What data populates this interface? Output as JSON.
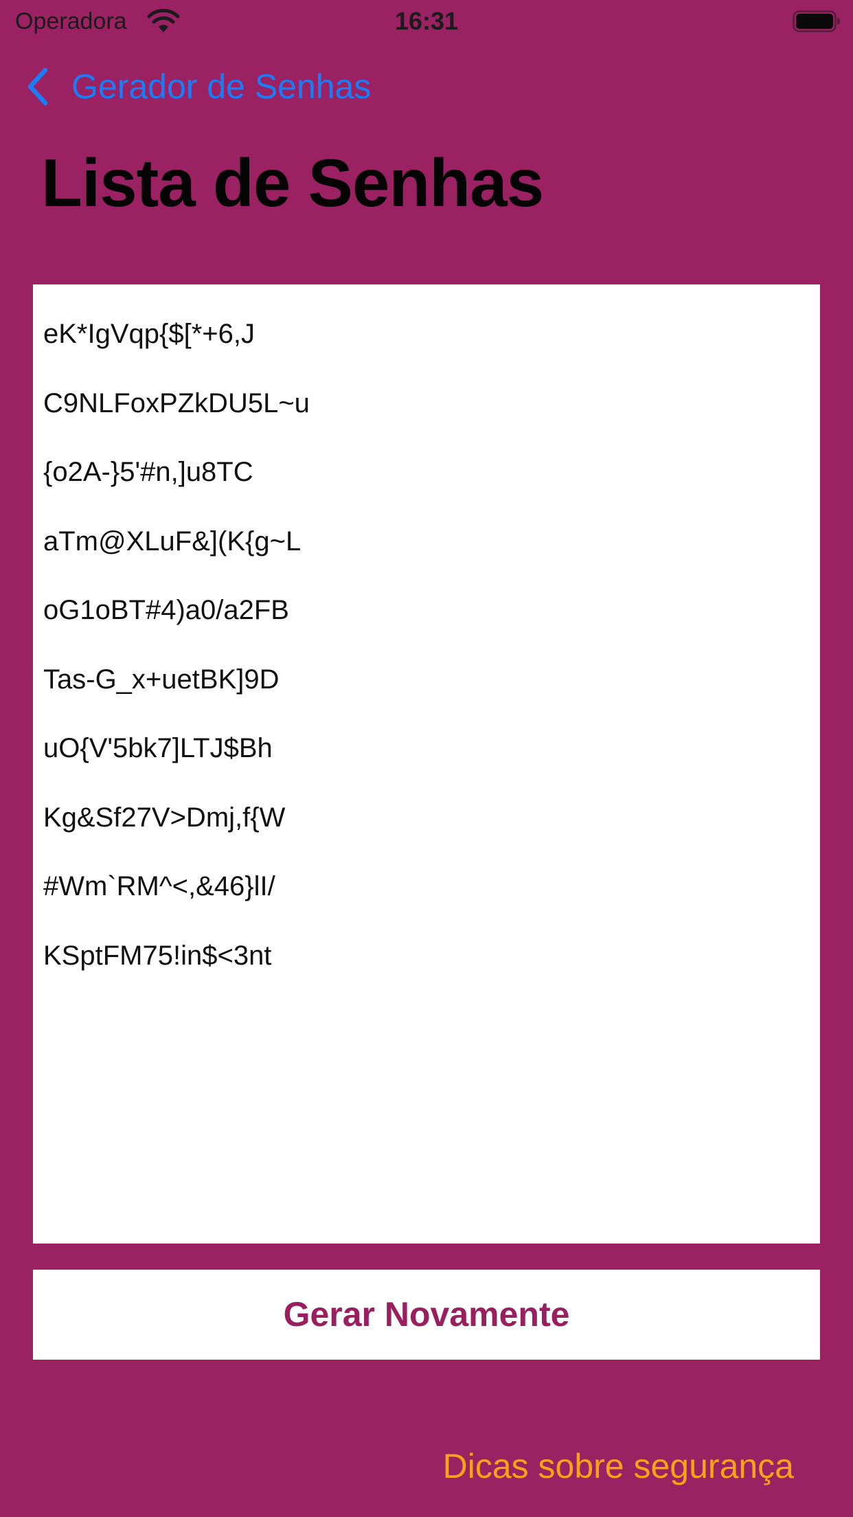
{
  "status_bar": {
    "carrier": "Operadora",
    "time": "16:31",
    "wifi_icon": "wifi-icon",
    "battery_icon": "battery-icon",
    "battery_level": 1.0
  },
  "nav": {
    "back_icon": "chevron-left-icon",
    "back_label": "Gerador de Senhas"
  },
  "page": {
    "title": "Lista de Senhas"
  },
  "passwords": [
    "eK*IgVqp{$[*+6,J",
    "C9NLFoxPZkDU5L~u",
    "{o2A-}5'#n,]u8TC",
    "aTm@XLuF&](K{g~L",
    "oG1oBT#4)a0/a2FB",
    "Tas-G_x+uetBK]9D",
    "uO{V'5bk7]LTJ$Bh",
    "Kg&Sf27V>Dmj,f{W",
    "#Wm`RM^<,&46}lI/",
    "KSptFM75!in$<3nt"
  ],
  "actions": {
    "regenerate_label": "Gerar Novamente",
    "tips_label": "Dicas sobre segurança"
  },
  "colors": {
    "background": "#9a2262",
    "nav_blue": "#1a7cf6",
    "button_text": "#98205f",
    "tips_orange": "#f7a21a"
  }
}
